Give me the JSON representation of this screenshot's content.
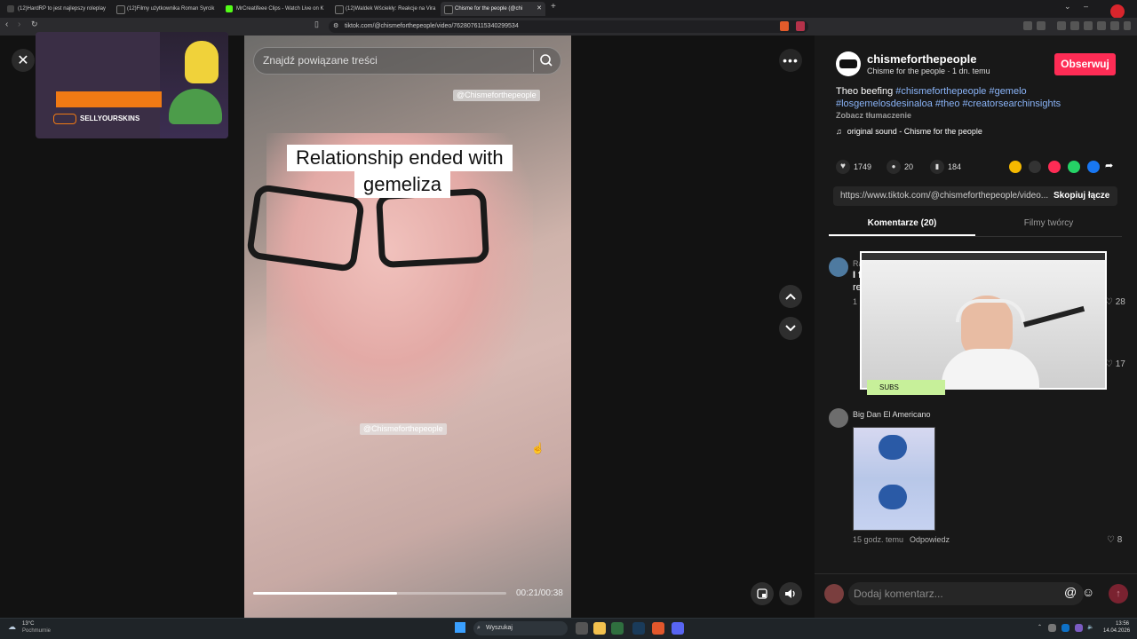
{
  "browser": {
    "tabs": [
      {
        "label": "(12)HardRP to jest najlepszy roleplay",
        "favicon_color": "#444444"
      },
      {
        "label": "(12)Filmy użytkownika Roman Syrcik",
        "favicon_color": "#222222"
      },
      {
        "label": "MrCreatifeee Clips - Watch Live on K",
        "favicon_color": "#53fc18"
      },
      {
        "label": "(12)Waldek Wściekły: Reakcje na Vira",
        "favicon_color": "#222222"
      },
      {
        "label": "Chisme for the people (@chi",
        "favicon_color": "#222222",
        "active": true
      }
    ],
    "new_tab": "+",
    "url": "tiktok.com/@chismeforthepeople/video/7628076115340299534"
  },
  "video": {
    "search_placeholder": "Znajdź powiązane treści",
    "caption_line1": "Relationship ended with",
    "caption_line2": "gemeliza",
    "watermark_top": "@Chismeforthepeople",
    "watermark_mid": "@Chismeforthepeople",
    "time": "00:21/00:38",
    "progress_fraction": 0.57
  },
  "ad": {
    "brand": "SELLYOURSKINS"
  },
  "post": {
    "username": "chismeforthepeople",
    "subtitle": "Chisme for the people · 1 dn. temu",
    "follow": "Obserwuj",
    "desc_text": "Theo beefing",
    "hashtags_line1": "#chismeforthepeople #gemelo",
    "hashtags_line2": "#losgemelosdesinaloa #theo #creatorsearchinsights",
    "translate": "Zobacz tłumaczenie",
    "sound": "original sound - Chisme for the people",
    "likes": "1749",
    "comments": "20",
    "saves": "184",
    "link": "https://www.tiktok.com/@chismeforthepeople/video...",
    "copy_link": "Skopiuj łącze",
    "tab_comments": "Komentarze (20)",
    "tab_creator": "Filmy twórcy"
  },
  "comments": [
    {
      "author": "Ra",
      "text": "I f",
      "text2": "re",
      "meta": "1",
      "likes": "28"
    },
    {
      "likes": "17"
    },
    {
      "author": "Big Dan El Americano",
      "meta": "15 godz. temu",
      "reply": "Odpowiedz",
      "likes": "8"
    }
  ],
  "stream": {
    "subs_label": "SUBS"
  },
  "comment_input": {
    "placeholder": "Dodaj komentarz..."
  },
  "taskbar": {
    "weather_temp": "13°C",
    "weather_desc": "Pochmurnie",
    "search": "Wyszukaj",
    "time": "13:56",
    "date": "14.04.2026"
  },
  "colors": {
    "accent": "#fe2c55",
    "link": "#8ab4f8"
  }
}
